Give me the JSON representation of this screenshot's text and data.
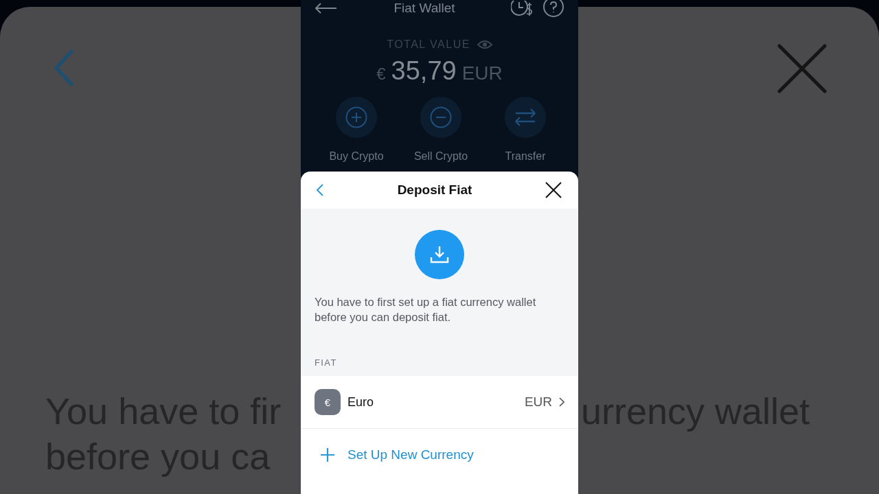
{
  "backdrop": {
    "left_lines": [
      "You have to fir",
      "before you ca"
    ],
    "right_lines": [
      "urrency wallet"
    ]
  },
  "wallet": {
    "title": "Fiat Wallet",
    "total_label": "TOTAL VALUE",
    "currency_symbol": "€",
    "amount": "35,79",
    "currency_code": "EUR",
    "actions": [
      {
        "kind": "buy",
        "label": "Buy Crypto"
      },
      {
        "kind": "sell",
        "label": "Sell Crypto"
      },
      {
        "kind": "transfer",
        "label": "Transfer"
      }
    ]
  },
  "sheet": {
    "title": "Deposit Fiat",
    "message": "You have to first set up a fiat currency wallet before you can deposit fiat.",
    "section_label": "FIAT",
    "currencies": [
      {
        "symbol": "€",
        "name": "Euro",
        "code": "EUR"
      }
    ],
    "add_action": {
      "label": "Set Up New Currency"
    }
  }
}
